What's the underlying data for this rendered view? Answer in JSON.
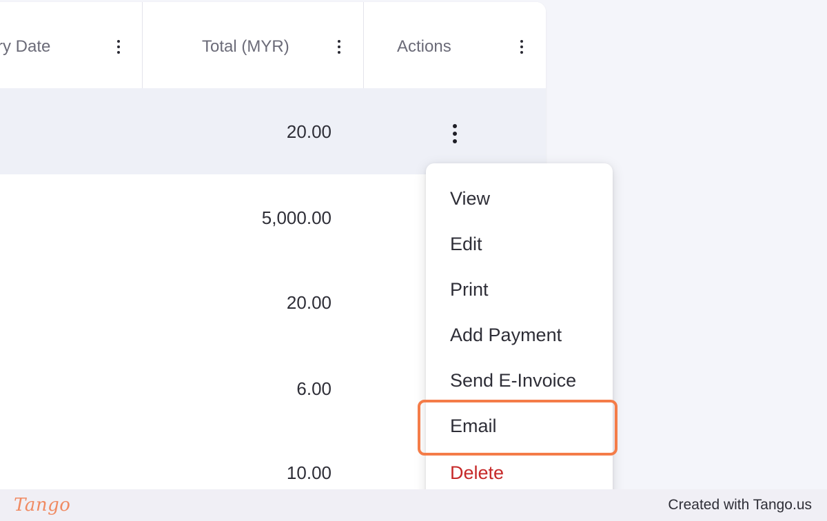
{
  "table": {
    "columns": [
      {
        "label": "ry Date"
      },
      {
        "label": "Total (MYR)"
      },
      {
        "label": "Actions"
      }
    ],
    "rows": [
      {
        "total": "20.00"
      },
      {
        "total": "5,000.00"
      },
      {
        "total": "20.00"
      },
      {
        "total": "6.00"
      },
      {
        "total": "10.00"
      }
    ]
  },
  "actions_menu": {
    "items": [
      {
        "label": "View"
      },
      {
        "label": "Edit"
      },
      {
        "label": "Print"
      },
      {
        "label": "Add Payment"
      },
      {
        "label": "Send E-Invoice"
      },
      {
        "label": "Email"
      },
      {
        "label": "Delete"
      }
    ],
    "highlighted": "Email"
  },
  "colors": {
    "highlight_border": "#f47c48",
    "danger": "#c62828",
    "selected_row": "#eef0f7"
  },
  "footer": {
    "brand": "Tango",
    "credit": "Created with Tango.us"
  }
}
